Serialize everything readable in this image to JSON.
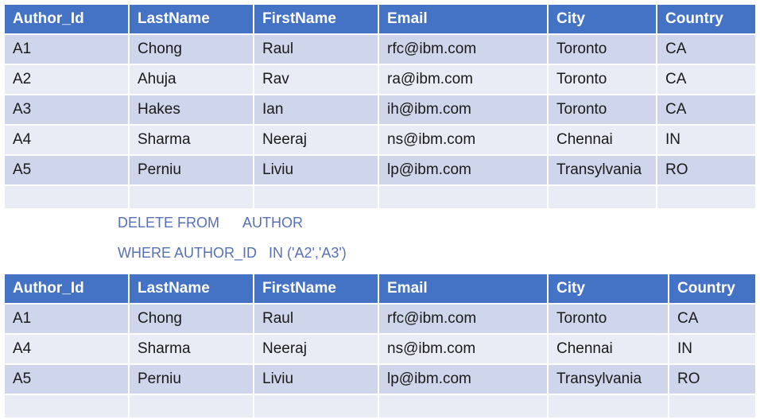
{
  "before_table": {
    "headers": [
      "Author_Id",
      "LastName",
      "FirstName",
      "Email",
      "City",
      "Country"
    ],
    "rows": [
      [
        "A1",
        "Chong",
        "Raul",
        "rfc@ibm.com",
        "Toronto",
        "CA"
      ],
      [
        "A2",
        "Ahuja",
        "Rav",
        "ra@ibm.com",
        "Toronto",
        "CA"
      ],
      [
        "A3",
        "Hakes",
        "Ian",
        "ih@ibm.com",
        "Toronto",
        "CA"
      ],
      [
        "A4",
        "Sharma",
        "Neeraj",
        "ns@ibm.com",
        "Chennai",
        "IN"
      ],
      [
        "A5",
        "Perniu",
        "Liviu",
        "lp@ibm.com",
        "Transylvania",
        "RO"
      ]
    ]
  },
  "sql": {
    "line1": "DELETE FROM      AUTHOR",
    "line2": "WHERE AUTHOR_ID   IN ('A2','A3')"
  },
  "after_table": {
    "headers": [
      "Author_Id",
      "LastName",
      "FirstName",
      "Email",
      "City",
      "Country"
    ],
    "rows": [
      [
        "A1",
        "Chong",
        "Raul",
        "rfc@ibm.com",
        "Toronto",
        "CA"
      ],
      [
        "A4",
        "Sharma",
        "Neeraj",
        "ns@ibm.com",
        "Chennai",
        "IN"
      ],
      [
        "A5",
        "Perniu",
        "Liviu",
        "lp@ibm.com",
        "Transylvania",
        "RO"
      ]
    ]
  },
  "colors": {
    "header_bg": "#4472c4",
    "row_dark": "#cfd5ea",
    "row_light": "#e9ebf5",
    "sql_text": "#5670b8"
  }
}
